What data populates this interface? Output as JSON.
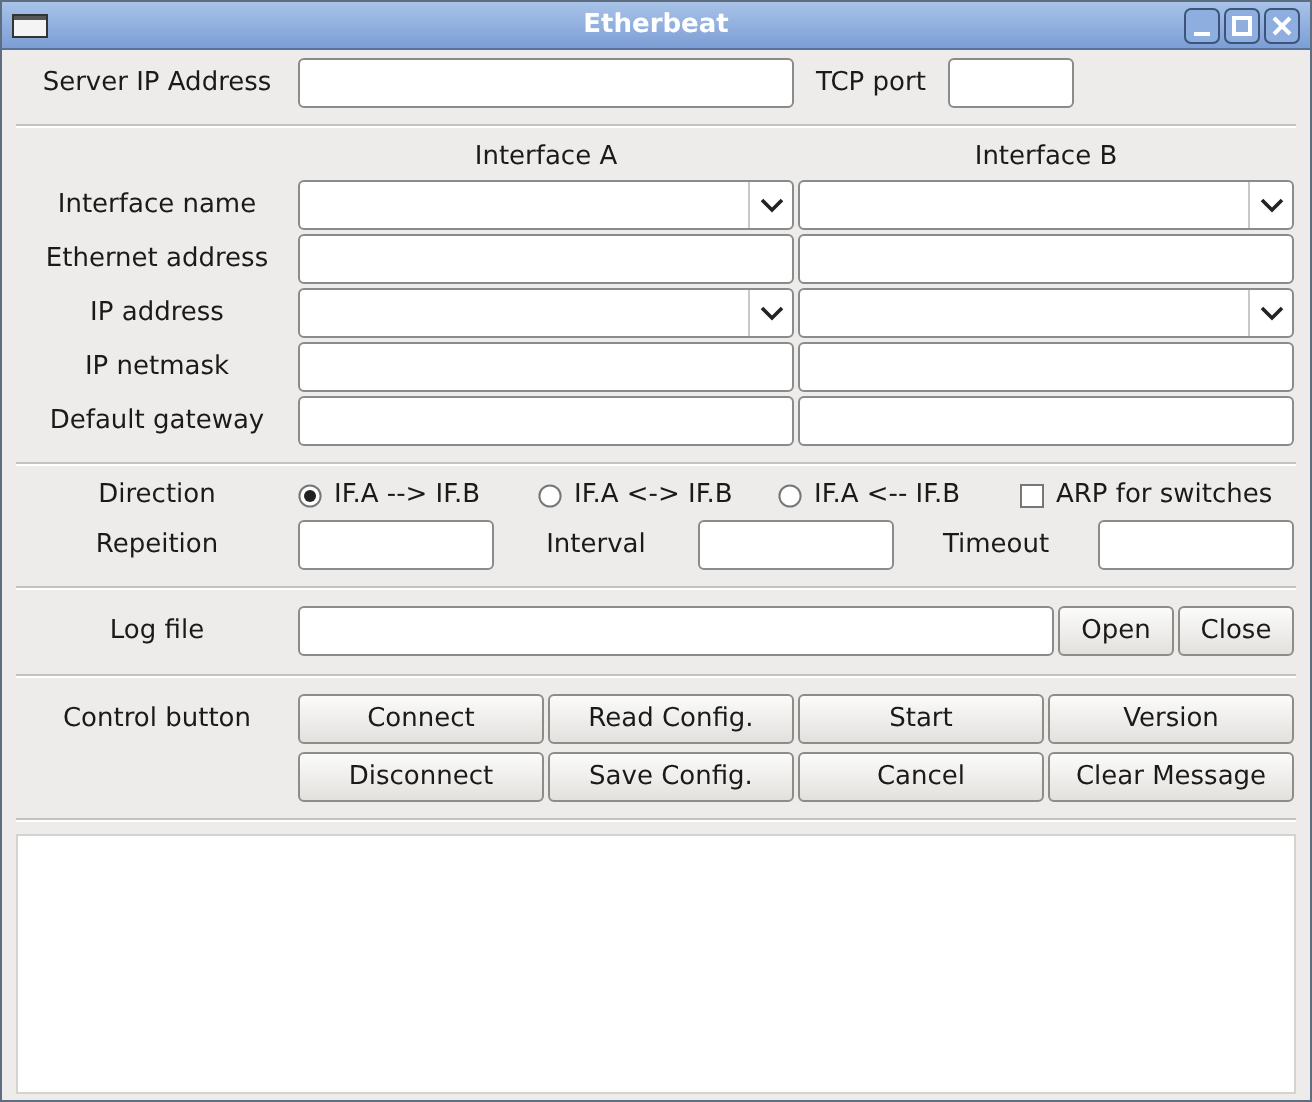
{
  "window": {
    "title": "Etherbeat"
  },
  "server": {
    "label": "Server IP Address",
    "port_label": "TCP port"
  },
  "interfaces": {
    "columns": [
      "Interface A",
      "Interface B"
    ],
    "rows": [
      {
        "label": "Interface name",
        "kind": "combo"
      },
      {
        "label": "Ethernet address",
        "kind": "entry"
      },
      {
        "label": "IP address",
        "kind": "combo"
      },
      {
        "label": "IP netmask",
        "kind": "entry"
      },
      {
        "label": "Default gateway",
        "kind": "entry"
      }
    ]
  },
  "direction": {
    "label": "Direction",
    "options": [
      {
        "label": "IF.A --> IF.B",
        "selected": true
      },
      {
        "label": "IF.A <-> IF.B",
        "selected": false
      },
      {
        "label": "IF.A <-- IF.B",
        "selected": false
      }
    ],
    "arp": {
      "label": "ARP for switches",
      "checked": false
    }
  },
  "timing": [
    {
      "label": "Repeition"
    },
    {
      "label": "Interval"
    },
    {
      "label": "Timeout"
    }
  ],
  "log": {
    "label": "Log file",
    "buttons": [
      "Open",
      "Close"
    ]
  },
  "control": {
    "label": "Control button",
    "buttons": [
      "Connect",
      "Read Config.",
      "Start",
      "Version",
      "Disconnect",
      "Save Config.",
      "Cancel",
      "Clear Message"
    ]
  }
}
